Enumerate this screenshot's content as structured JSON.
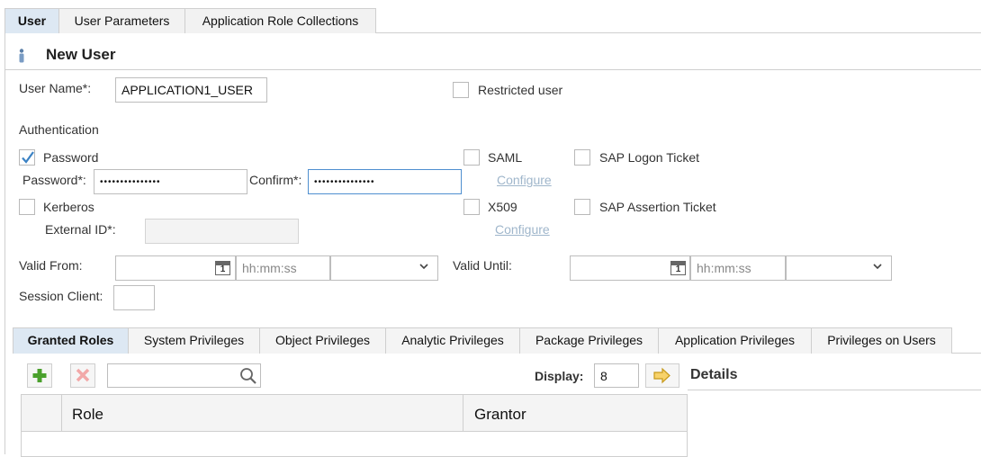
{
  "top_tabs": [
    "User",
    "User Parameters",
    "Application Role Collections"
  ],
  "header": {
    "title": "New User"
  },
  "user_name": {
    "label": "User Name*:",
    "value": "APPLICATION1_USER"
  },
  "restricted_user": {
    "label": "Restricted user",
    "checked": false
  },
  "authentication": {
    "heading": "Authentication",
    "password": {
      "label": "Password",
      "checked": true
    },
    "password_field": {
      "label": "Password*:",
      "value": "•••••••••••••••"
    },
    "confirm_field": {
      "label": "Confirm*:",
      "value": "•••••••••••••••"
    },
    "saml": {
      "label": "SAML",
      "checked": false,
      "configure": "Configure"
    },
    "sap_logon_ticket": {
      "label": "SAP Logon Ticket",
      "checked": false
    },
    "kerberos": {
      "label": "Kerberos",
      "checked": false
    },
    "external_id": {
      "label": "External ID*:",
      "value": ""
    },
    "x509": {
      "label": "X509",
      "checked": false,
      "configure": "Configure"
    },
    "sap_assertion_ticket": {
      "label": "SAP Assertion Ticket",
      "checked": false
    }
  },
  "validity": {
    "valid_from": {
      "label": "Valid From:",
      "date": "",
      "time_placeholder": "hh:mm:ss",
      "zone": ""
    },
    "valid_until": {
      "label": "Valid Until:",
      "date": "",
      "time_placeholder": "hh:mm:ss",
      "zone": ""
    },
    "calendar_day": "1"
  },
  "session_client": {
    "label": "Session Client:",
    "value": ""
  },
  "role_tabs": [
    "Granted Roles",
    "System Privileges",
    "Object Privileges",
    "Analytic Privileges",
    "Package Privileges",
    "Application Privileges",
    "Privileges on Users"
  ],
  "roles_toolbar": {
    "search_value": "",
    "display_label": "Display:",
    "display_value": "8",
    "details_label": "Details"
  },
  "roles_table": {
    "columns": [
      "Role",
      "Grantor"
    ],
    "rows": []
  },
  "colors": {
    "accent": "#4f8fd0",
    "active_tab": "#dde8f3",
    "check": "#3b82c4"
  },
  "icons": [
    "person-icon",
    "calendar-icon",
    "chevron-down-icon",
    "add-icon",
    "delete-icon",
    "search-icon",
    "arrow-right-icon",
    "checkmark-icon"
  ]
}
